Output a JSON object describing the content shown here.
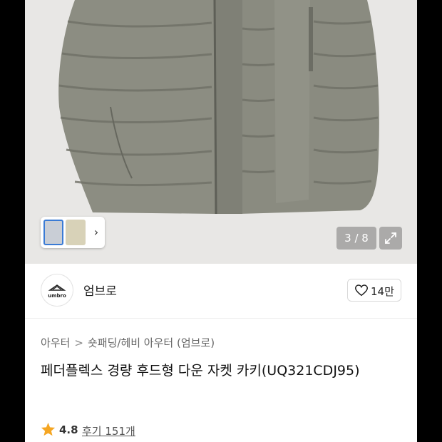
{
  "gallery": {
    "counter": "3 / 8",
    "thumb_arrow": "›"
  },
  "brand": {
    "logo_text": "umbro",
    "name": "엄브로",
    "likes": "14만"
  },
  "breadcrumb": {
    "category": "아우터",
    "separator": ">",
    "subcategory": "숏패딩/헤비 아우터 (엄브로)"
  },
  "product": {
    "title": "페더플렉스 경량 후드형 다운 자켓 카키(UQ321CDJ95)",
    "rating": "4.8",
    "reviews": "후기 151개"
  },
  "colors": {
    "star": "#f5a623",
    "jacket": "#8a8b80"
  }
}
